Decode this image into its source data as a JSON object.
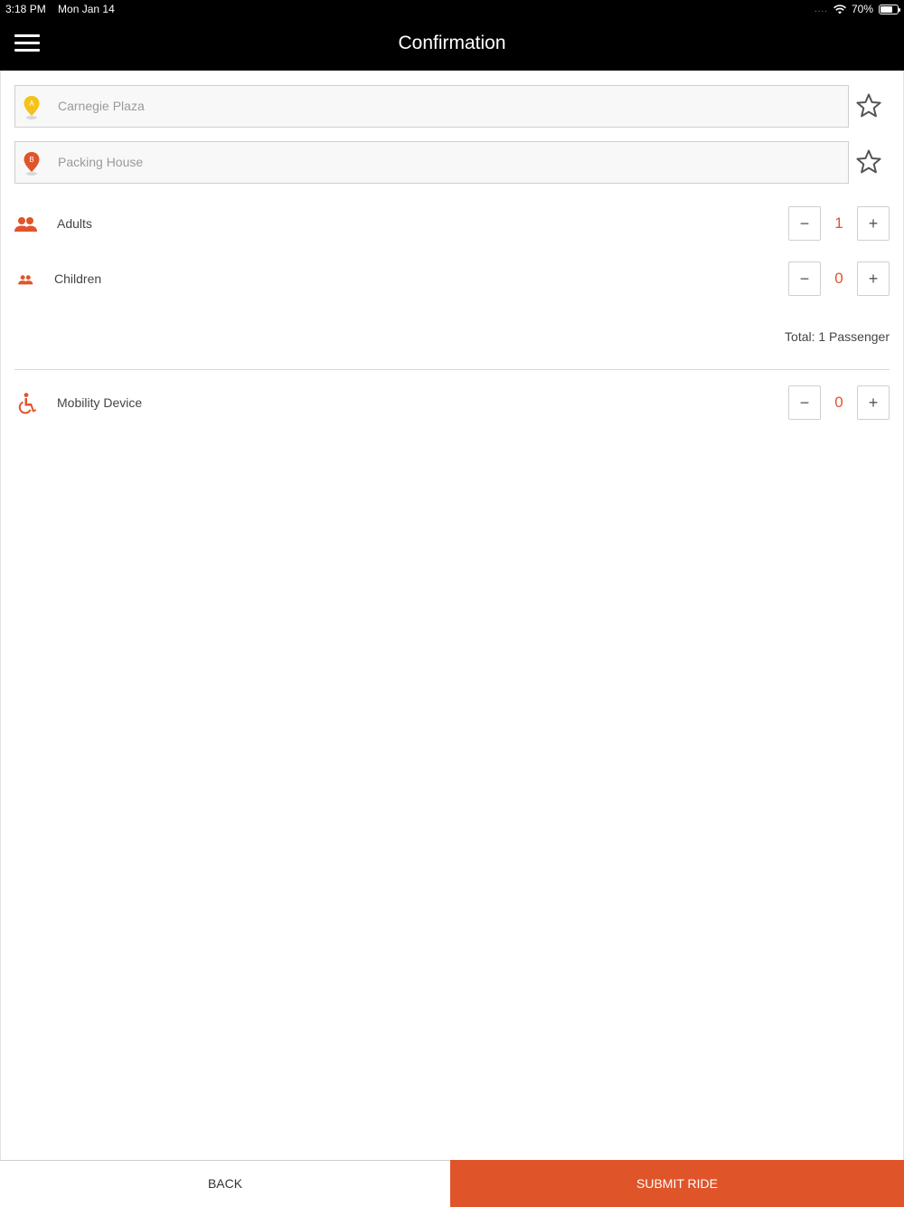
{
  "status_bar": {
    "time": "3:18 PM",
    "date": "Mon Jan 14",
    "signal_dots": "....",
    "battery_percent_text": "70%",
    "battery_level": 0.7,
    "wifi_icon": "wifi-icon"
  },
  "header": {
    "title": "Confirmation",
    "menu_icon": "hamburger-menu-icon"
  },
  "locations": {
    "pickup": {
      "marker_letter": "A",
      "marker_color": "#f5c21b",
      "label": "Carnegie Plaza",
      "favorite_icon": "star-outline-icon"
    },
    "dropoff": {
      "marker_letter": "B",
      "marker_color": "#e0542a",
      "label": "Packing House",
      "favorite_icon": "star-outline-icon"
    }
  },
  "passengers": {
    "adults": {
      "label": "Adults",
      "value": "1",
      "icon": "people-icon"
    },
    "children": {
      "label": "Children",
      "value": "0",
      "icon": "people-small-icon"
    },
    "total_text": "Total: 1 Passenger"
  },
  "mobility": {
    "label": "Mobility Device",
    "value": "0",
    "icon": "wheelchair-icon"
  },
  "stepper": {
    "minus": "−",
    "plus": "+"
  },
  "actions": {
    "back_label": "BACK",
    "submit_label": "SUBMIT RIDE"
  },
  "colors": {
    "accent": "#e0542a",
    "header_bg": "#000000",
    "pin_a": "#f5c21b",
    "pin_b": "#e0542a"
  }
}
